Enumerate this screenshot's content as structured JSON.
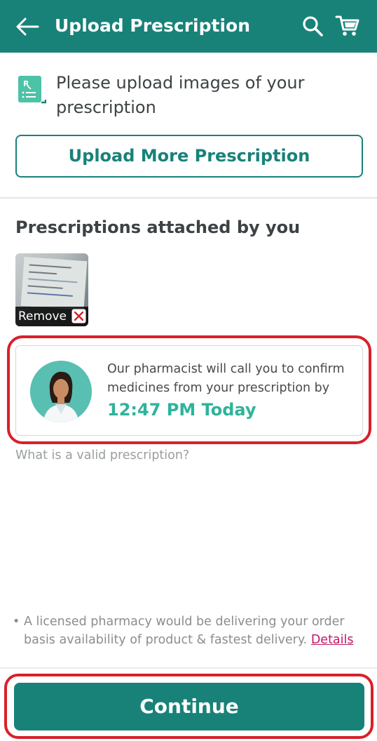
{
  "header": {
    "title": "Upload Prescription",
    "back_icon": "arrow-left-icon",
    "search_icon": "search-icon",
    "cart_icon": "cart-icon",
    "color": "#188279"
  },
  "upload_section": {
    "icon": "prescription-rx-icon",
    "intro_text": "Please upload images of your prescription",
    "upload_button_label": "Upload More Prescription"
  },
  "attached": {
    "title": "Prescriptions attached by you",
    "items": [
      {
        "remove_label": "Remove",
        "remove_icon": "close-x-icon"
      }
    ]
  },
  "pharmacist_card": {
    "message": "Our pharmacist will call you to confirm medicines from your prescription by",
    "time": "12:47 PM Today",
    "time_color": "#2fb39b"
  },
  "valid_prescription_link": "What is a valid prescription?",
  "note": {
    "bullet": "•",
    "text": "A licensed pharmacy would be delivering your order basis availability of product & fastest delivery.",
    "details_label": "Details",
    "details_color": "#c2186b"
  },
  "continue_button": {
    "label": "Continue"
  },
  "highlight_color": "#d9202a"
}
